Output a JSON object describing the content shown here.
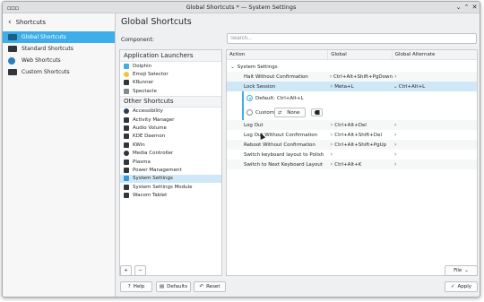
{
  "window": {
    "title": "Global Shortcuts * — System Settings"
  },
  "sidebar": {
    "back_label": "Shortcuts",
    "items": [
      {
        "label": "Global Shortcuts",
        "active": true
      },
      {
        "label": "Standard Shortcuts"
      },
      {
        "label": "Web Shortcuts"
      },
      {
        "label": "Custom Shortcuts"
      }
    ]
  },
  "main": {
    "title": "Global Shortcuts",
    "component_label": "Component:",
    "search_placeholder": "Search...",
    "app_launchers_header": "Application Launchers",
    "app_launchers": [
      "Dolphin",
      "Emoji Selector",
      "KRunner",
      "Spectacle"
    ],
    "other_shortcuts_header": "Other Shortcuts",
    "other_shortcuts": [
      "Accessibility",
      "Activity Manager",
      "Audio Volume",
      "KDE Daemon",
      "KWin",
      "Media Controller",
      "Plasma",
      "Power Management",
      "System Settings",
      "System Settings Module",
      "Wacom Tablet"
    ],
    "selected_component": "System Settings"
  },
  "table": {
    "headers": [
      "Action",
      "Global",
      "Global Alternate"
    ],
    "group": "System Settings",
    "rows": [
      {
        "action": "Halt Without Confirmation",
        "global": "Ctrl+Alt+Shift+PgDown",
        "alt": ""
      },
      {
        "action": "Lock Session",
        "global": "Meta+L",
        "alt": "Ctrl+Alt+L"
      },
      {
        "action": "Log Out",
        "global": "Ctrl+Alt+Del",
        "alt": ""
      },
      {
        "action": "Log Out Without Confirmation",
        "global": "Ctrl+Alt+Shift+Del",
        "alt": ""
      },
      {
        "action": "Reboot Without Confirmation",
        "global": "Ctrl+Alt+Shift+PgUp",
        "alt": ""
      },
      {
        "action": "Switch keyboard layout to Polish",
        "global": "",
        "alt": ""
      },
      {
        "action": "Switch to Next Keyboard Layout",
        "global": "Ctrl+Alt+K",
        "alt": ""
      }
    ],
    "editor": {
      "default_label": "Default:",
      "default_value": "Ctrl+Alt+L",
      "custom_label": "Custom:",
      "custom_value": "None"
    }
  },
  "buttons": {
    "add": "+",
    "remove": "−",
    "file": "File",
    "help": "Help",
    "defaults": "Defaults",
    "reset": "Reset",
    "apply": "Apply"
  }
}
